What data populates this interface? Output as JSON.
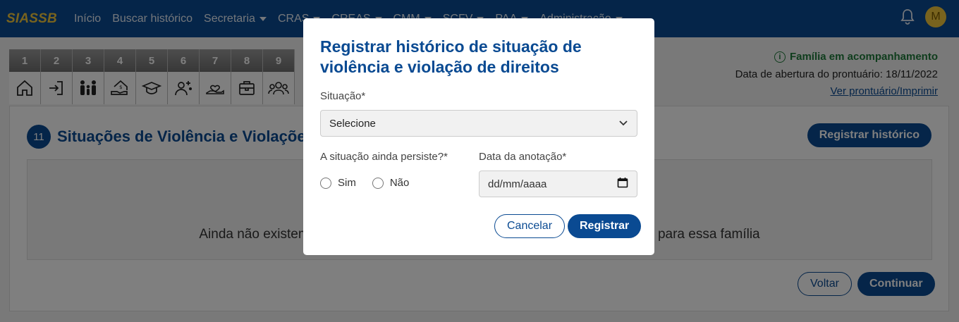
{
  "navbar": {
    "brand": "SIASSB",
    "items": [
      {
        "label": "Início",
        "dropdown": false
      },
      {
        "label": "Buscar histórico",
        "dropdown": false
      },
      {
        "label": "Secretaria",
        "dropdown": true
      },
      {
        "label": "CRAS",
        "dropdown": true
      },
      {
        "label": "CREAS",
        "dropdown": true
      },
      {
        "label": "CMM",
        "dropdown": true
      },
      {
        "label": "SCFV",
        "dropdown": true
      },
      {
        "label": "PAA",
        "dropdown": true
      },
      {
        "label": "Administração",
        "dropdown": true
      }
    ],
    "avatar_initial": "M"
  },
  "steps": [
    {
      "num": "1",
      "icon": "home-icon"
    },
    {
      "num": "2",
      "icon": "login-icon"
    },
    {
      "num": "3",
      "icon": "family-icon"
    },
    {
      "num": "4",
      "icon": "house-money-icon"
    },
    {
      "num": "5",
      "icon": "graduation-cap-icon"
    },
    {
      "num": "6",
      "icon": "health-icon"
    },
    {
      "num": "7",
      "icon": "hand-heart-icon"
    },
    {
      "num": "8",
      "icon": "briefcase-icon"
    },
    {
      "num": "9",
      "icon": "community-icon"
    }
  ],
  "family": {
    "status": "Família em acompanhamento",
    "open_date": "Data de abertura do prontuário: 18/11/2022",
    "link": "Ver prontuário/Imprimir"
  },
  "section": {
    "number": "11",
    "title": "Situações de Violência e Violações de Direitos",
    "register_button": "Registrar histórico",
    "empty_message": "Ainda não existem registros de situações de violência e violações de direitos para essa família",
    "back_button": "Voltar",
    "continue_button": "Continuar"
  },
  "modal": {
    "title": "Registrar histórico de situação de violência e violação de direitos",
    "situation_label": "Situação*",
    "situation_value": "Selecione",
    "persist_label": "A situação ainda persiste?*",
    "option_yes": "Sim",
    "option_no": "Não",
    "date_label": "Data da anotação*",
    "date_placeholder": "dd/mm/aaaa",
    "cancel": "Cancelar",
    "submit": "Registrar"
  },
  "colors": {
    "primary": "#0a4a92",
    "brand_yellow": "#f0c63c",
    "success": "#1f7a3a"
  }
}
